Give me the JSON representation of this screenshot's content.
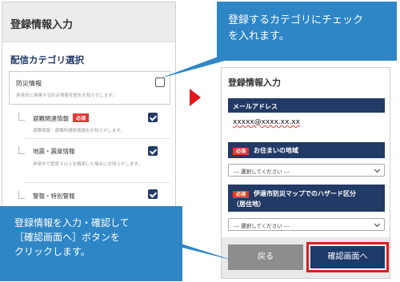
{
  "left_screen": {
    "title": "登録情報入力",
    "section_title": "配信カテゴリ選択",
    "category": {
      "title": "防災情報",
      "description": "伊達市に関連する防災情報全般をお知らせします。",
      "checked": false
    },
    "subcategories": [
      {
        "title": "避難関連情報",
        "badge": "必須",
        "description": "避難情報・避難所開設情報をお知らせします。",
        "checked": true
      },
      {
        "title": "地震・震度情報",
        "badge": "",
        "description": "伊達市で震度４以上を観測した場合にお知らせします。",
        "checked": true
      },
      {
        "title": "警報・特別警報",
        "badge": "",
        "description": "",
        "checked": true
      }
    ]
  },
  "right_screen": {
    "title": "登録情報入力",
    "email_label": "メールアドレス",
    "email_value": "xxxxx@xxxx.xx.xx",
    "area_label": "お住まいの地域",
    "area_required": "必須",
    "area_select": "--- 選択してください ---",
    "hazard_label_line1": "伊達市防災マップでのハザード区分",
    "hazard_label_line2": "（居住地）",
    "hazard_required": "必須",
    "hazard_select": "--- 選択してください ---",
    "back_button": "戻る",
    "confirm_button": "確認画面へ"
  },
  "callouts": {
    "top_line1": "登録するカテゴリにチェック",
    "top_line2": "を入れます。",
    "bottom_line1": "登録情報を入力・確認して",
    "bottom_line2": "［確認画面へ］ボタンを",
    "bottom_line3": "クリックします。"
  },
  "colors": {
    "navy": "#223a66",
    "callout_blue": "#2e86c6",
    "highlight_red": "#e0191d",
    "badge_red": "#e53935"
  }
}
